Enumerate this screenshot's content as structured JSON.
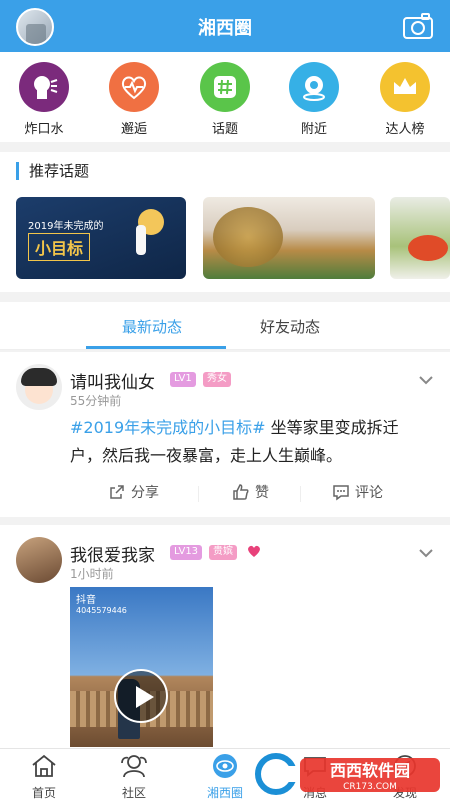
{
  "header": {
    "title": "湘西圈"
  },
  "categories": [
    {
      "label": "炸口水",
      "icon": "speaking-head-icon",
      "color": "#7b2a7c"
    },
    {
      "label": "邂逅",
      "icon": "heartbeat-icon",
      "color": "#f07042"
    },
    {
      "label": "话题",
      "icon": "hashtag-icon",
      "color": "#5ac54a"
    },
    {
      "label": "附近",
      "icon": "location-target-icon",
      "color": "#36b0e6"
    },
    {
      "label": "达人榜",
      "icon": "crown-icon",
      "color": "#f4c22f"
    }
  ],
  "topics": {
    "heading": "推荐话题",
    "cards": [
      {
        "small": "2019年未完成的",
        "big": "小目标"
      }
    ]
  },
  "tabs": [
    {
      "label": "最新动态"
    },
    {
      "label": "好友动态"
    }
  ],
  "posts": [
    {
      "username": "请叫我仙女",
      "level": "LV1",
      "role": "秀女",
      "time": "55分钟前",
      "tag": "#2019年未完成的小目标#",
      "text": " 坐等家里变成拆迁户，然后我一夜暴富，走上人生巅峰。",
      "actions": {
        "share": "分享",
        "like": "赞",
        "comment": "评论"
      }
    },
    {
      "username": "我很爱我家",
      "level": "LV13",
      "role": "贵嫔",
      "time": "1小时前",
      "video": {
        "app": "抖音",
        "id": "4045579446"
      }
    }
  ],
  "bottom_nav": [
    {
      "label": "首页"
    },
    {
      "label": "社区"
    },
    {
      "label": "湘西圈"
    },
    {
      "label": "消息"
    },
    {
      "label": "发现"
    }
  ],
  "watermark": {
    "brand": "西西软件园",
    "site": "CR173.COM"
  },
  "colors": {
    "primary": "#3aa0e8",
    "badge_level": "#e49be0",
    "badge_role": "#f49cc5"
  }
}
